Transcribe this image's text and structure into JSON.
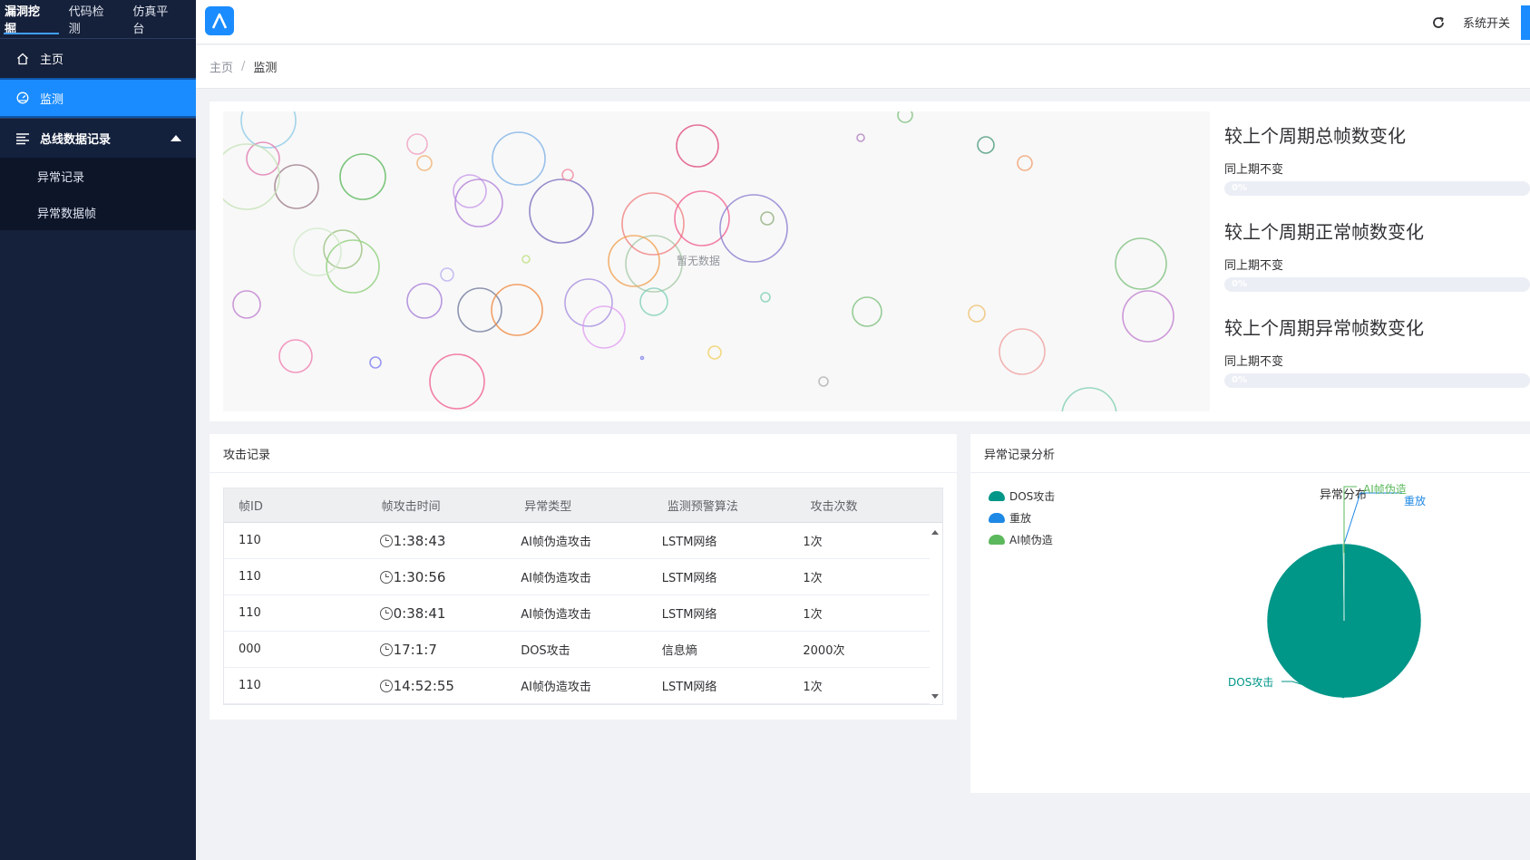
{
  "sidebar": {
    "top_tabs": [
      "漏洞挖掘",
      "代码检测",
      "仿真平台"
    ],
    "items": [
      {
        "label": "主页",
        "icon": "home-icon"
      },
      {
        "label": "监测",
        "icon": "dashboard-icon"
      },
      {
        "label": "总线数据记录",
        "icon": "list-icon"
      }
    ],
    "sub_items": [
      "异常记录",
      "异常数据帧"
    ]
  },
  "header": {
    "logo": "logo-icon",
    "system_switch": "系统开关"
  },
  "breadcrumb": {
    "home": "主页",
    "separator": "/",
    "current": "监测"
  },
  "bubbles": {
    "empty_text": "暂无数据"
  },
  "stats": [
    {
      "title": "较上个周期总帧数变化",
      "sub": "同上期不变",
      "percent": "0%"
    },
    {
      "title": "较上个周期正常帧数变化",
      "sub": "同上期不变",
      "percent": "0%"
    },
    {
      "title": "较上个周期异常帧数变化",
      "sub": "同上期不变",
      "percent": "0%"
    }
  ],
  "attack_card": {
    "title": "攻击记录",
    "columns": [
      "帧ID",
      "帧攻击时间",
      "异常类型",
      "监测预警算法",
      "攻击次数"
    ],
    "rows": [
      [
        "110",
        "1:38:43",
        "AI帧伪造攻击",
        "LSTM网络",
        "1次"
      ],
      [
        "110",
        "1:30:56",
        "AI帧伪造攻击",
        "LSTM网络",
        "1次"
      ],
      [
        "110",
        "0:38:41",
        "AI帧伪造攻击",
        "LSTM网络",
        "1次"
      ],
      [
        "000",
        "17:1:7",
        "DOS攻击",
        "信息熵",
        "2000次"
      ],
      [
        "110",
        "14:52:55",
        "AI帧伪造攻击",
        "LSTM网络",
        "1次"
      ]
    ]
  },
  "analysis_card": {
    "title": "异常记录分析",
    "pie_title": "异常分布",
    "legend": [
      {
        "name": "DOS攻击",
        "color": "#009688"
      },
      {
        "name": "重放",
        "color": "#1e88e5"
      },
      {
        "name": "AI帧伪造",
        "color": "#5cb85c"
      }
    ]
  },
  "chart_data": {
    "type": "pie",
    "title": "异常分布",
    "labels": [
      "DOS攻击",
      "重放",
      "AI帧伪造"
    ],
    "values": [
      2000,
      0,
      4
    ],
    "colors": [
      "#009688",
      "#1e88e5",
      "#5cb85c"
    ]
  },
  "colors": {
    "accent": "#1a8cff",
    "sidebar_bg": "#15203a"
  }
}
